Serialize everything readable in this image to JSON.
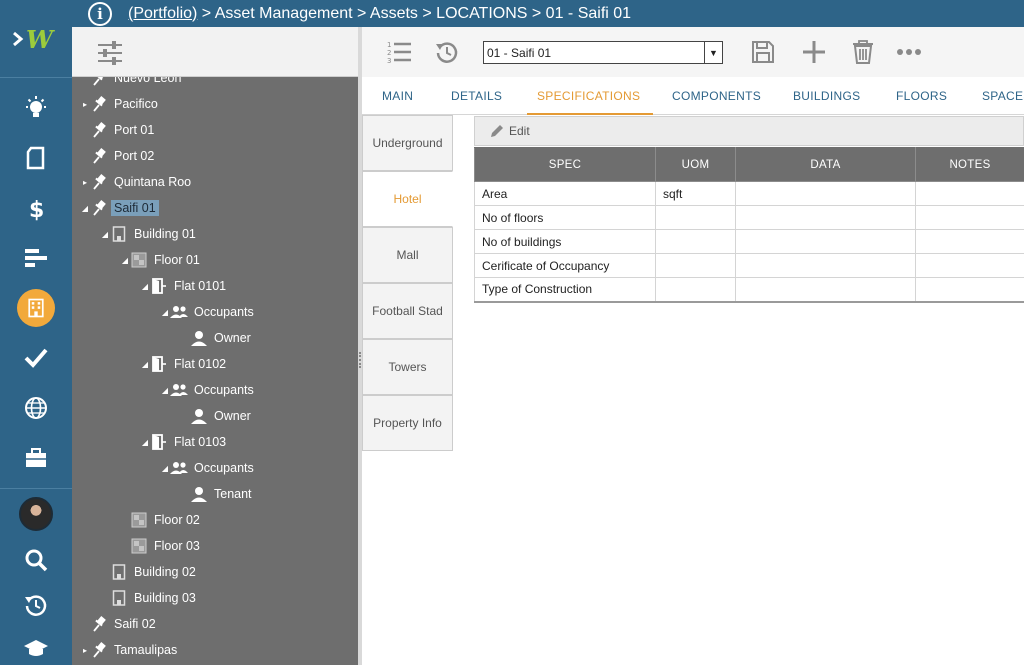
{
  "breadcrumb": {
    "portfolio_link": "(Portfolio)",
    "rest": " > Asset Management > Assets > LOCATIONS > 01 - Saifi 01"
  },
  "rail": {
    "logo": "W",
    "items": [
      "bulb-icon",
      "document-icon",
      "dollar-icon",
      "gantt-icon",
      "building-icon",
      "check-icon",
      "globe-icon",
      "briefcase-icon",
      "avatar",
      "search-icon",
      "history-icon",
      "graduation-cap-icon"
    ],
    "active": "building-icon",
    "accent_color": "#f2a93b",
    "bg_color": "#2e6488"
  },
  "tree": {
    "items": [
      {
        "label": "Nuevo Leon",
        "icon": "pin-icon",
        "arrow": "",
        "indent": 0
      },
      {
        "label": "Pacifico",
        "icon": "pin-icon",
        "arrow": "▸",
        "indent": 0
      },
      {
        "label": "Port 01",
        "icon": "pin-icon",
        "arrow": "",
        "indent": 0
      },
      {
        "label": "Port 02",
        "icon": "pin-icon",
        "arrow": "",
        "indent": 0
      },
      {
        "label": "Quintana Roo",
        "icon": "pin-icon",
        "arrow": "▸",
        "indent": 0
      },
      {
        "label": "Saifi 01",
        "icon": "pin-icon",
        "arrow": "◢",
        "indent": 0,
        "selected": true
      },
      {
        "label": "Building 01",
        "icon": "building-icon",
        "arrow": "◢",
        "indent": 1
      },
      {
        "label": "Floor 01",
        "icon": "floor-icon",
        "arrow": "◢",
        "indent": 2
      },
      {
        "label": "Flat 0101",
        "icon": "door-icon",
        "arrow": "◢",
        "indent": 3
      },
      {
        "label": "Occupants",
        "icon": "people-icon",
        "arrow": "◢",
        "indent": 4
      },
      {
        "label": "Owner",
        "icon": "person-icon",
        "arrow": "",
        "indent": 5
      },
      {
        "label": "Flat 0102",
        "icon": "door-icon",
        "arrow": "◢",
        "indent": 3
      },
      {
        "label": "Occupants",
        "icon": "people-icon",
        "arrow": "◢",
        "indent": 4
      },
      {
        "label": "Owner",
        "icon": "person-icon",
        "arrow": "",
        "indent": 5
      },
      {
        "label": "Flat 0103",
        "icon": "door-icon",
        "arrow": "◢",
        "indent": 3
      },
      {
        "label": "Occupants",
        "icon": "people-icon",
        "arrow": "◢",
        "indent": 4
      },
      {
        "label": "Tenant",
        "icon": "person-icon",
        "arrow": "",
        "indent": 5
      },
      {
        "label": "Floor 02",
        "icon": "floor-icon",
        "arrow": "",
        "indent": 2
      },
      {
        "label": "Floor 03",
        "icon": "floor-icon",
        "arrow": "",
        "indent": 2
      },
      {
        "label": "Building 02",
        "icon": "building-icon",
        "arrow": "",
        "indent": 1
      },
      {
        "label": "Building 03",
        "icon": "building-icon",
        "arrow": "",
        "indent": 1
      },
      {
        "label": "Saifi 02",
        "icon": "pin-icon",
        "arrow": "",
        "indent": 0
      },
      {
        "label": "Tamaulipas",
        "icon": "pin-icon",
        "arrow": "▸",
        "indent": 0
      }
    ]
  },
  "toolbar": {
    "record_select_value": "01 - Saifi 01",
    "buttons": [
      "list-icon",
      "history-icon",
      "save-icon",
      "add-icon",
      "delete-icon",
      "more-icon"
    ]
  },
  "tabs": [
    "MAIN",
    "DETAILS",
    "SPECIFICATIONS",
    "COMPONENTS",
    "BUILDINGS",
    "FLOORS",
    "SPACES"
  ],
  "active_tab": "SPECIFICATIONS",
  "subtabs": [
    "Underground",
    "Hotel",
    "Mall",
    "Football Stad",
    "Towers",
    "Property Info"
  ],
  "active_subtab": "Hotel",
  "spec": {
    "edit_label": "Edit",
    "columns": [
      "SPEC",
      "UOM",
      "DATA",
      "NOTES"
    ],
    "rows": [
      [
        "Area",
        "sqft",
        "",
        ""
      ],
      [
        "No of floors",
        "",
        "",
        ""
      ],
      [
        "No of buildings",
        "",
        "",
        ""
      ],
      [
        "Cerificate of Occupancy",
        "",
        "",
        ""
      ],
      [
        "Type of Construction",
        "",
        "",
        ""
      ]
    ]
  },
  "colors": {
    "accent": "#e49a34",
    "primary": "#2e6488",
    "tree_bg": "#6e6e6e"
  }
}
